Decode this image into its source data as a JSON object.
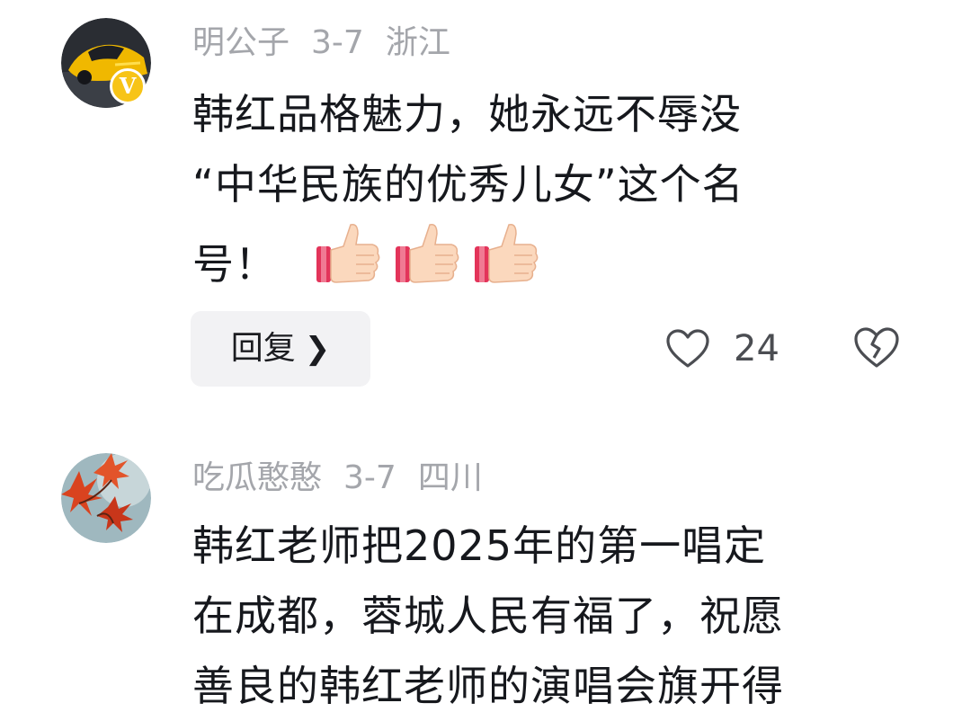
{
  "comments": [
    {
      "username": "明公子",
      "date": "3-7",
      "location": "浙江",
      "lines": [
        "韩红品格魅力，她永远不辱没",
        "“中华民族的优秀儿女”这个名",
        "号！"
      ],
      "emoji_count": 3,
      "verified_badge": "V",
      "reply_label": "回复",
      "like_count": "24"
    },
    {
      "username": "吃瓜憨憨",
      "date": "3-7",
      "location": "四川",
      "lines": [
        "韩红老师把2025年的第一唱定",
        "在成都，蓉城人民有福了，祝愿",
        "善良的韩红老师的演唱会旗开得"
      ]
    }
  ],
  "icons": {
    "like": "heart-outline-icon",
    "dislike": "broken-heart-icon",
    "reply_chevron": "chevron-right-icon",
    "thumbs": "thumbs-up-emoji"
  },
  "colors": {
    "meta_text": "#a4a6ab",
    "body_text": "#16181d",
    "badge": "#f7c417",
    "reply_bg": "#f2f2f4"
  }
}
